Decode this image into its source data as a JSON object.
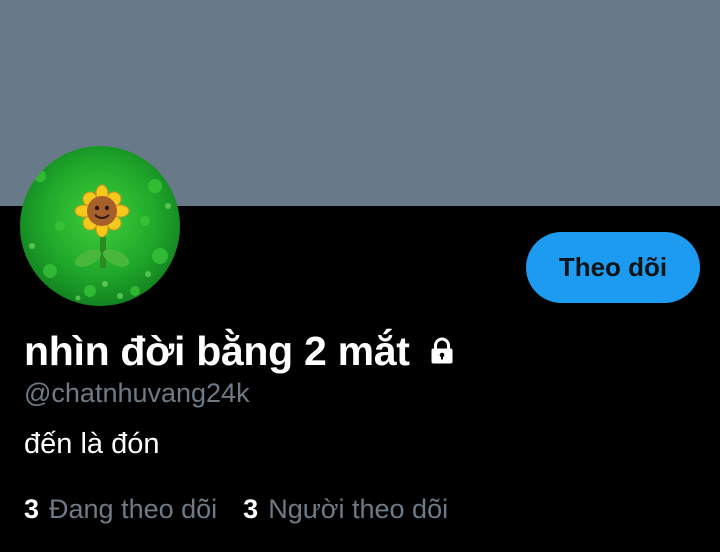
{
  "profile": {
    "banner_color": "#687a8a",
    "avatar_icon": "sunflower-avatar-icon",
    "follow_button_label": "Theo dõi",
    "display_name": "nhìn đời bằng 2 mắt",
    "protected_icon": "lock-icon",
    "handle": "@chatnhuvang24k",
    "bio": "đến là đón",
    "stats": {
      "following_count": "3",
      "following_label": "Đang theo dõi",
      "followers_count": "3",
      "followers_label": "Người theo dõi"
    }
  },
  "colors": {
    "accent": "#1d9bf0",
    "background": "#000000",
    "secondary_text": "#6e7b86",
    "primary_text": "#ffffff"
  }
}
